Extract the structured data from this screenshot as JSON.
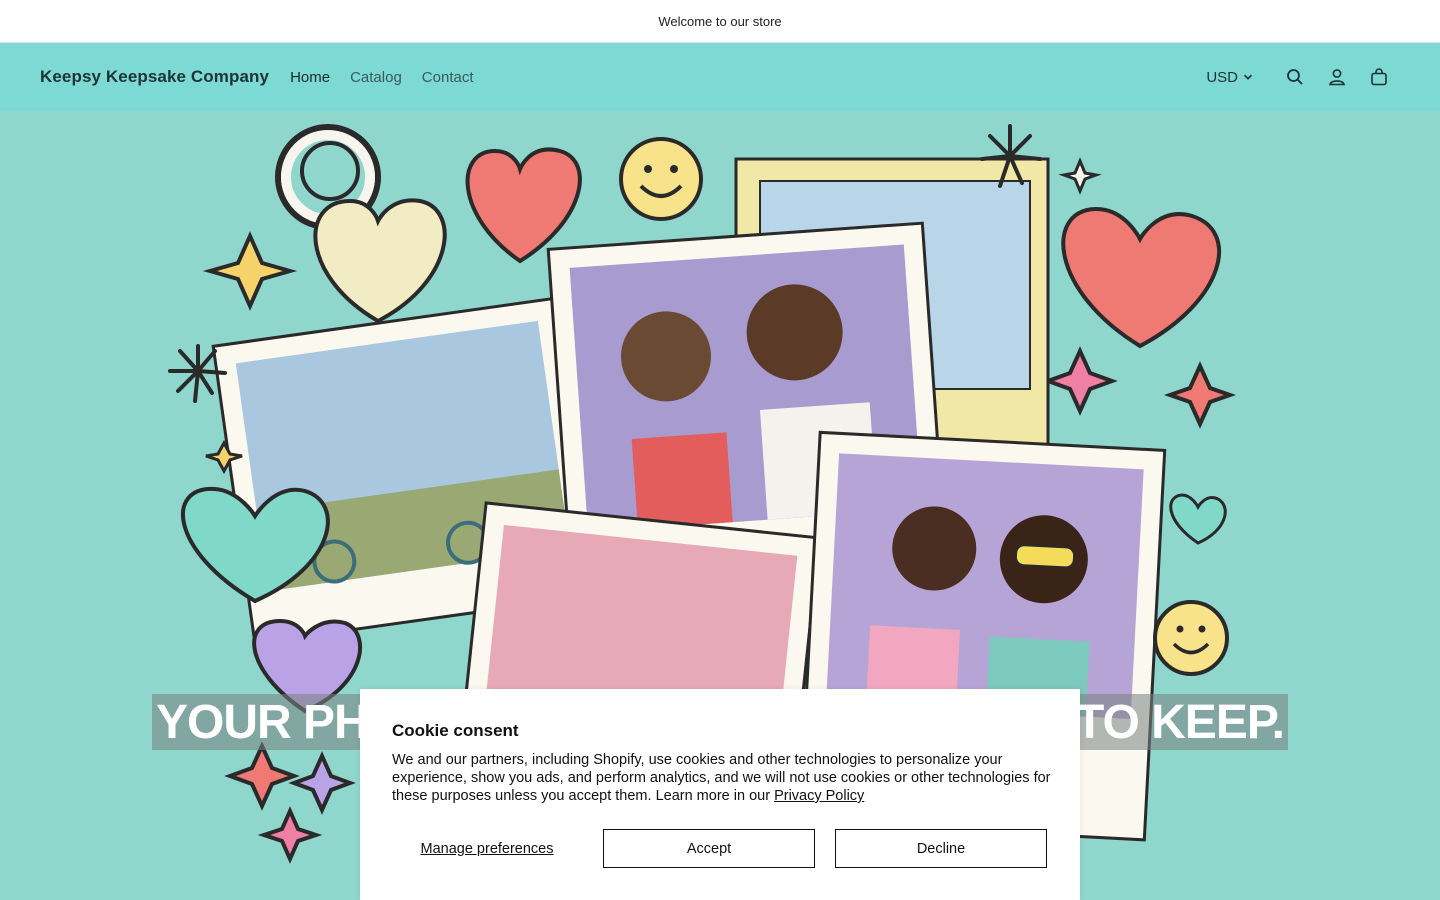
{
  "announcement": "Welcome to our store",
  "header": {
    "brand": "Keepsy Keepsake Company",
    "nav": [
      {
        "label": "Home"
      },
      {
        "label": "Catalog"
      },
      {
        "label": "Contact"
      }
    ],
    "currency": "USD",
    "icons": [
      "search-icon",
      "account-icon",
      "cart-icon"
    ]
  },
  "hero": {
    "heading_left": "YOUR PH",
    "heading_right": "TO KEEP.",
    "colors": {
      "background": "#8fd6cd",
      "header": "#7dd9d4"
    }
  },
  "cookie": {
    "title": "Cookie consent",
    "body": "We and our partners, including Shopify, use cookies and other technologies to personalize your experience, show you ads, and perform analytics, and we will not use cookies or other technologies for these purposes unless you accept them. Learn more in our ",
    "link": "Privacy Policy",
    "manage": "Manage preferences",
    "accept": "Accept",
    "decline": "Decline"
  }
}
